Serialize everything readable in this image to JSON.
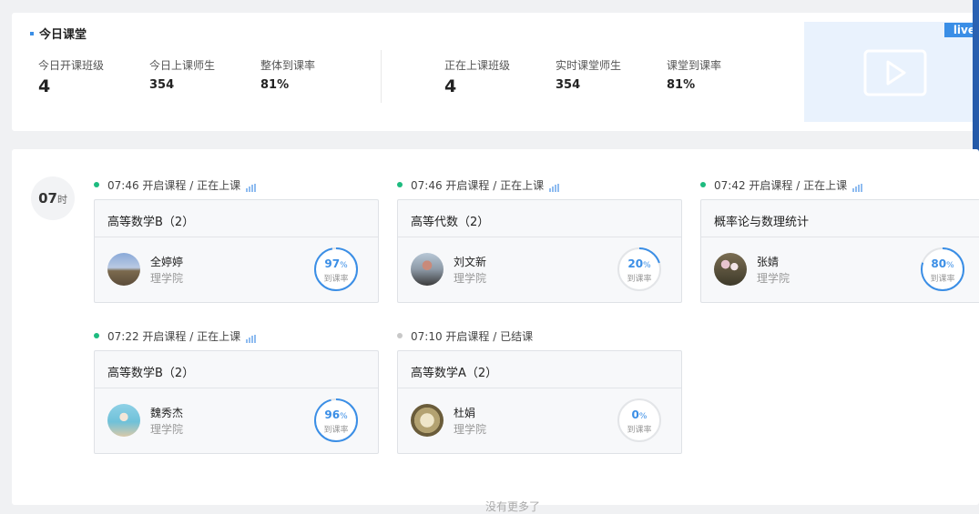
{
  "summary": {
    "title": "今日课堂",
    "stats": [
      {
        "label": "今日开课班级",
        "value": "4"
      },
      {
        "label": "今日上课师生",
        "value": "354"
      },
      {
        "label": "整体到课率",
        "value": "81%"
      },
      {
        "label": "正在上课班级",
        "value": "4"
      },
      {
        "label": "实时课堂师生",
        "value": "354"
      },
      {
        "label": "课堂到课率",
        "value": "81%"
      }
    ],
    "live_badge": "live"
  },
  "hour": {
    "value": "07",
    "unit": "时"
  },
  "rate_label": "到课率",
  "percent_sign": "%",
  "courses": [
    {
      "time_status": "07:46 开启课程 / 正在上课",
      "live": true,
      "name": "高等数学B（2）",
      "teacher": "全婷婷",
      "dept": "理学院",
      "rate": "97",
      "rate_fraction": 0.97,
      "avatar": "landscape"
    },
    {
      "time_status": "07:46 开启课程 / 正在上课",
      "live": true,
      "name": "高等代数（2）",
      "teacher": "刘文新",
      "dept": "理学院",
      "rate": "20",
      "rate_fraction": 0.2,
      "avatar": "person-outdoor"
    },
    {
      "time_status": "07:42 开启课程 / 正在上课",
      "live": true,
      "name": "概率论与数理统计",
      "teacher": "张婧",
      "dept": "理学院",
      "rate": "80",
      "rate_fraction": 0.8,
      "avatar": "flowers"
    },
    {
      "time_status": "07:22 开启课程 / 正在上课",
      "live": true,
      "name": "高等数学B（2）",
      "teacher": "魏秀杰",
      "dept": "理学院",
      "rate": "96",
      "rate_fraction": 0.96,
      "avatar": "beach"
    },
    {
      "time_status": "07:10 开启课程 / 已结课",
      "live": false,
      "name": "高等数学A（2）",
      "teacher": "杜娟",
      "dept": "理学院",
      "rate": "0",
      "rate_fraction": 0.0,
      "avatar": "flower-closeup"
    }
  ],
  "footer": "没有更多了",
  "colors": {
    "accent": "#3a8ee6",
    "live_dot": "#1dbb7f",
    "ended_dot": "#c8c8c8"
  }
}
